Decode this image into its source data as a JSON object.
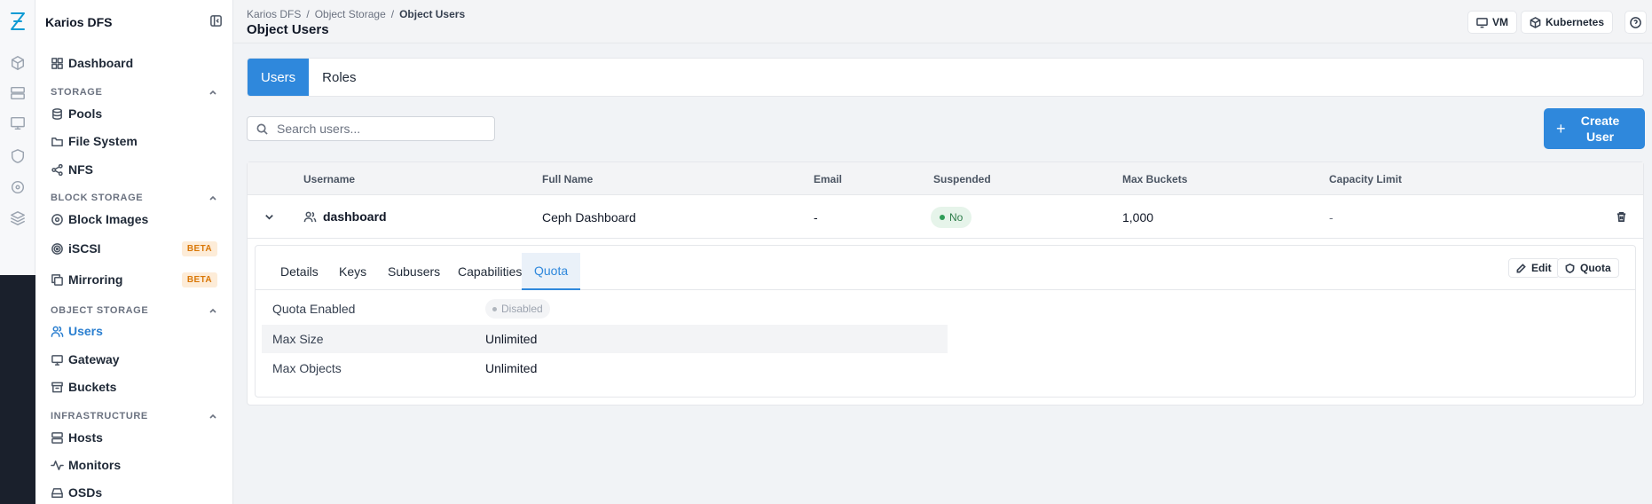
{
  "app": {
    "name": "Karios DFS"
  },
  "sidebar": {
    "dashboard": "Dashboard",
    "sections": {
      "storage": "STORAGE",
      "block_storage": "BLOCK STORAGE",
      "object_storage": "OBJECT STORAGE",
      "infrastructure": "INFRASTRUCTURE"
    },
    "items": {
      "pools": "Pools",
      "file_system": "File System",
      "nfs": "NFS",
      "block_images": "Block Images",
      "iscsi": "iSCSI",
      "mirroring": "Mirroring",
      "users": "Users",
      "gateway": "Gateway",
      "buckets": "Buckets",
      "hosts": "Hosts",
      "monitors": "Monitors",
      "osds": "OSDs"
    },
    "beta_label": "BETA"
  },
  "header": {
    "breadcrumb": [
      "Karios DFS",
      "Object Storage",
      "Object Users"
    ],
    "separator": "/",
    "title": "Object Users",
    "vm_label": "VM",
    "kubernetes_label": "Kubernetes"
  },
  "tabs": [
    "Users",
    "Roles"
  ],
  "search": {
    "placeholder": "Search users..."
  },
  "create_button": "Create User",
  "table": {
    "columns": [
      "Username",
      "Full Name",
      "Email",
      "Suspended",
      "Max Buckets",
      "Capacity Limit"
    ],
    "rows": [
      {
        "username": "dashboard",
        "full_name": "Ceph Dashboard",
        "email": "-",
        "suspended": "No",
        "max_buckets": "1,000",
        "capacity_limit": "-"
      }
    ]
  },
  "detail": {
    "tabs": [
      "Details",
      "Keys",
      "Subusers",
      "Capabilities",
      "Quota"
    ],
    "active_tab": "Quota",
    "edit_label": "Edit",
    "quota_label": "Quota",
    "rows": [
      {
        "label": "Quota Enabled",
        "value": "Disabled"
      },
      {
        "label": "Max Size",
        "value": "Unlimited"
      },
      {
        "label": "Max Objects",
        "value": "Unlimited"
      }
    ]
  },
  "colors": {
    "accent": "#2f88dc",
    "beta": "#d97706",
    "success": "#2e7d4a"
  }
}
